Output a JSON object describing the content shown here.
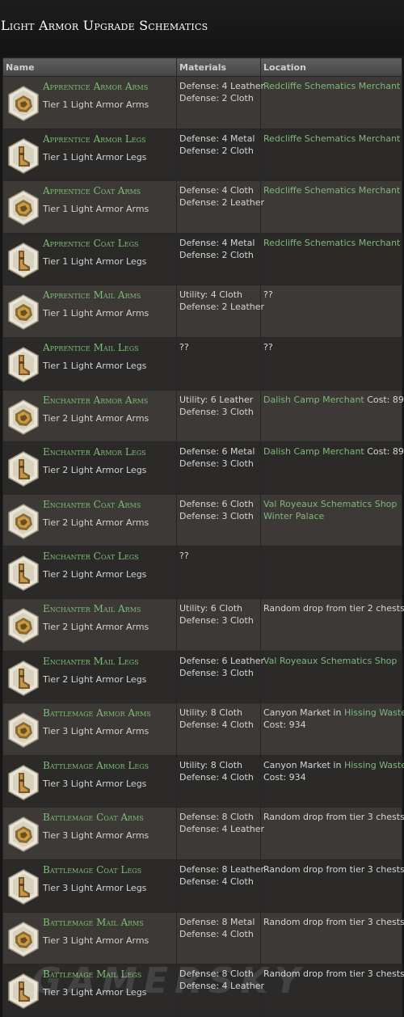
{
  "page": {
    "title": "Light Armor Upgrade Schematics"
  },
  "table": {
    "headers": {
      "name": "Name",
      "materials": "Materials",
      "location": "Location"
    },
    "rows": [
      {
        "icon": "arms-icon",
        "name": "Apprentice Armor Arms",
        "tier": "Tier 1 Light Armor Arms",
        "materials": [
          "Defense: 4 Leather",
          "Defense: 2 Cloth"
        ],
        "location": [
          [
            {
              "t": "Redcliffe Schematics Merchant",
              "link": true
            }
          ]
        ]
      },
      {
        "icon": "legs-icon",
        "name": "Apprentice Armor Legs",
        "tier": "Tier 1 Light Armor Legs",
        "materials": [
          "Defense: 4 Metal",
          "Defense: 2 Cloth"
        ],
        "location": [
          [
            {
              "t": "Redcliffe Schematics Merchant",
              "link": true
            }
          ]
        ]
      },
      {
        "icon": "arms-icon",
        "name": "Apprentice Coat Arms",
        "tier": "Tier 1 Light Armor Arms",
        "materials": [
          "Defense: 4 Cloth",
          "Defense: 2 Leather"
        ],
        "location": [
          [
            {
              "t": "Redcliffe Schematics Merchant",
              "link": true
            }
          ]
        ]
      },
      {
        "icon": "legs-icon",
        "name": "Apprentice Coat Legs",
        "tier": "Tier 1 Light Armor Legs",
        "materials": [
          "Defense: 4 Metal",
          "Defense: 2 Cloth"
        ],
        "location": [
          [
            {
              "t": "Redcliffe Schematics Merchant",
              "link": true
            }
          ]
        ]
      },
      {
        "icon": "arms-icon",
        "name": "Apprentice Mail Arms",
        "tier": "Tier 1 Light Armor Arms",
        "materials": [
          "Utility: 4 Cloth",
          "Defense: 2 Leather"
        ],
        "location": [
          [
            {
              "t": "??",
              "link": false
            }
          ]
        ]
      },
      {
        "icon": "legs-icon",
        "name": "Apprentice Mail Legs",
        "tier": "Tier 1 Light Armor Legs",
        "materials": [
          "??"
        ],
        "location": [
          [
            {
              "t": "??",
              "link": false
            }
          ]
        ]
      },
      {
        "icon": "arms-icon",
        "name": "Enchanter Armor Arms",
        "tier": "Tier 2 Light Armor Arms",
        "materials": [
          "Utility: 6 Leather",
          "Defense: 3 Cloth"
        ],
        "location": [
          [
            {
              "t": "Dalish Camp Merchant",
              "link": true
            },
            {
              "t": " Cost: 89",
              "link": false
            }
          ]
        ]
      },
      {
        "icon": "legs-icon",
        "name": "Enchanter Armor Legs",
        "tier": "Tier 2 Light Armor Legs",
        "materials": [
          "Defense: 6 Metal",
          "Defense: 3 Cloth"
        ],
        "location": [
          [
            {
              "t": "Dalish Camp Merchant",
              "link": true
            },
            {
              "t": " Cost: 89",
              "link": false
            }
          ]
        ]
      },
      {
        "icon": "arms-icon",
        "name": "Enchanter Coat Arms",
        "tier": "Tier 2 Light Armor Arms",
        "materials": [
          "Defense: 6 Cloth",
          "Defense: 3 Cloth"
        ],
        "location": [
          [
            {
              "t": "Val Royeaux Schematics Shop",
              "link": true
            }
          ],
          [
            {
              "t": "Winter Palace",
              "link": true
            }
          ]
        ]
      },
      {
        "icon": "legs-icon",
        "name": "Enchanter Coat Legs",
        "tier": "Tier 2 Light Armor Legs",
        "materials": [
          "??"
        ],
        "location": []
      },
      {
        "icon": "arms-icon",
        "name": "Enchanter Mail Arms",
        "tier": "Tier 2 Light Armor Arms",
        "materials": [
          "Utility: 6 Cloth",
          "Defense: 3 Cloth"
        ],
        "location": [
          [
            {
              "t": "Random drop from tier 2 chests",
              "link": false
            }
          ]
        ]
      },
      {
        "icon": "legs-icon",
        "name": "Enchanter Mail Legs",
        "tier": "Tier 2 Light Armor Legs",
        "materials": [
          "Defense: 6 Leather",
          "Defense: 3 Cloth"
        ],
        "location": [
          [
            {
              "t": "Val Royeaux Schematics Shop",
              "link": true
            }
          ]
        ]
      },
      {
        "icon": "arms-icon",
        "name": "Battlemage Armor Arms",
        "tier": "Tier 3 Light Armor Arms",
        "materials": [
          "Utility: 8 Cloth",
          "Defense: 4 Cloth"
        ],
        "location": [
          [
            {
              "t": "Canyon Market in ",
              "link": false
            },
            {
              "t": "Hissing Wastes",
              "link": true
            }
          ],
          [
            {
              "t": "Cost: 934",
              "link": false
            }
          ]
        ]
      },
      {
        "icon": "legs-icon",
        "name": "Battlemage Armor Legs",
        "tier": "Tier 3 Light Armor Legs",
        "materials": [
          "Utility: 8 Cloth",
          "Defense: 4 Cloth"
        ],
        "location": [
          [
            {
              "t": "Canyon Market in ",
              "link": false
            },
            {
              "t": "Hissing Wastes",
              "link": true
            }
          ],
          [
            {
              "t": "Cost: 934",
              "link": false
            }
          ]
        ]
      },
      {
        "icon": "arms-icon",
        "name": "Battlemage Coat Arms",
        "tier": "Tier 3 Light Armor Arms",
        "materials": [
          "Defense: 8 Cloth",
          "Defense: 4 Leather"
        ],
        "location": [
          [
            {
              "t": "Random drop from tier 3 chests",
              "link": false
            }
          ]
        ]
      },
      {
        "icon": "legs-icon",
        "name": "Battlemage Coat Legs",
        "tier": "Tier 3 Light Armor Legs",
        "materials": [
          "Defense: 8 Leather",
          "Defense: 4 Cloth"
        ],
        "location": [
          [
            {
              "t": "Random drop from tier 3 chests",
              "link": false
            }
          ]
        ]
      },
      {
        "icon": "arms-icon",
        "name": "Battlemage Mail Arms",
        "tier": "Tier 3 Light Armor Arms",
        "materials": [
          "Defense: 8 Metal",
          "Defense: 4 Cloth"
        ],
        "location": [
          [
            {
              "t": "Random drop from tier 3 chests",
              "link": false
            }
          ]
        ]
      },
      {
        "icon": "legs-icon",
        "name": "Battlemage Mail Legs",
        "tier": "Tier 3 Light Armor Legs",
        "materials": [
          "Defense: 8 Cloth",
          "Defense: 4 Leather"
        ],
        "location": [
          [
            {
              "t": "Random drop from tier 3 chests",
              "link": false
            }
          ]
        ]
      }
    ]
  },
  "watermark": "GAMERSKY",
  "colors": {
    "link": "#7fb87a",
    "row_odd": "#3c3936",
    "row_even": "#2b2a29",
    "header": "#4f4f4f"
  }
}
